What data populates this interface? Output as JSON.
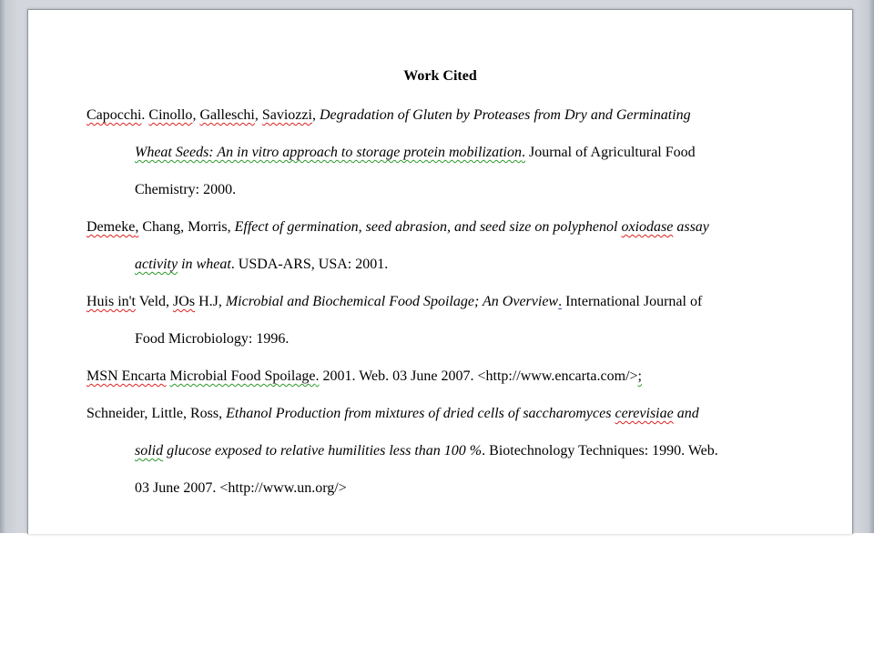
{
  "document": {
    "title": "Work Cited",
    "references": [
      {
        "lines": [
          [
            "Capocchi",
            ". ",
            "Cinollo",
            ", ",
            "Galleschi",
            ", ",
            "Saviozzi",
            ", ",
            "Degradation of Gluten by Proteases from Dry and Germinating"
          ],
          [
            "Wheat Seeds: An in vitro approach to storage protein mobilization",
            ".",
            " Journal of Agricultural Food"
          ],
          [
            "Chemistry: 2000."
          ]
        ]
      },
      {
        "lines": [
          [
            "Demeke",
            ",",
            " Chang, Morris, ",
            "Effect of germination, seed abrasion, and seed size on polyphenol ",
            "oxiodase",
            " assay"
          ],
          [
            "activity",
            " in wheat",
            ". USDA-ARS, USA: 2001."
          ]
        ]
      },
      {
        "lines": [
          [
            "Huis in't",
            " Veld, ",
            "JOs",
            " H.J, ",
            "Microbial and Biochemical Food Spoilage; An Overview",
            ".",
            " International Journal of"
          ],
          [
            "Food Microbiology: 1996."
          ]
        ]
      },
      {
        "lines": [
          [
            "MSN Encarta",
            " ",
            "Microbial Food Spoilage",
            ".",
            " 2001. Web. 03 June 2007. <http://www.encarta.com/>",
            ";"
          ]
        ]
      },
      {
        "lines": [
          [
            "Schneider, Little, Ross, ",
            "Ethanol Production from mixtures of dried cells of saccharomyces ",
            "cerevisiae",
            " and"
          ],
          [
            "solid",
            " glucose exposed to relative humilities less than 100 %",
            ". Biotechnology Techniques: 1990. Web."
          ],
          [
            "03 June 2007. <http://www.un.org/>"
          ]
        ]
      }
    ]
  }
}
